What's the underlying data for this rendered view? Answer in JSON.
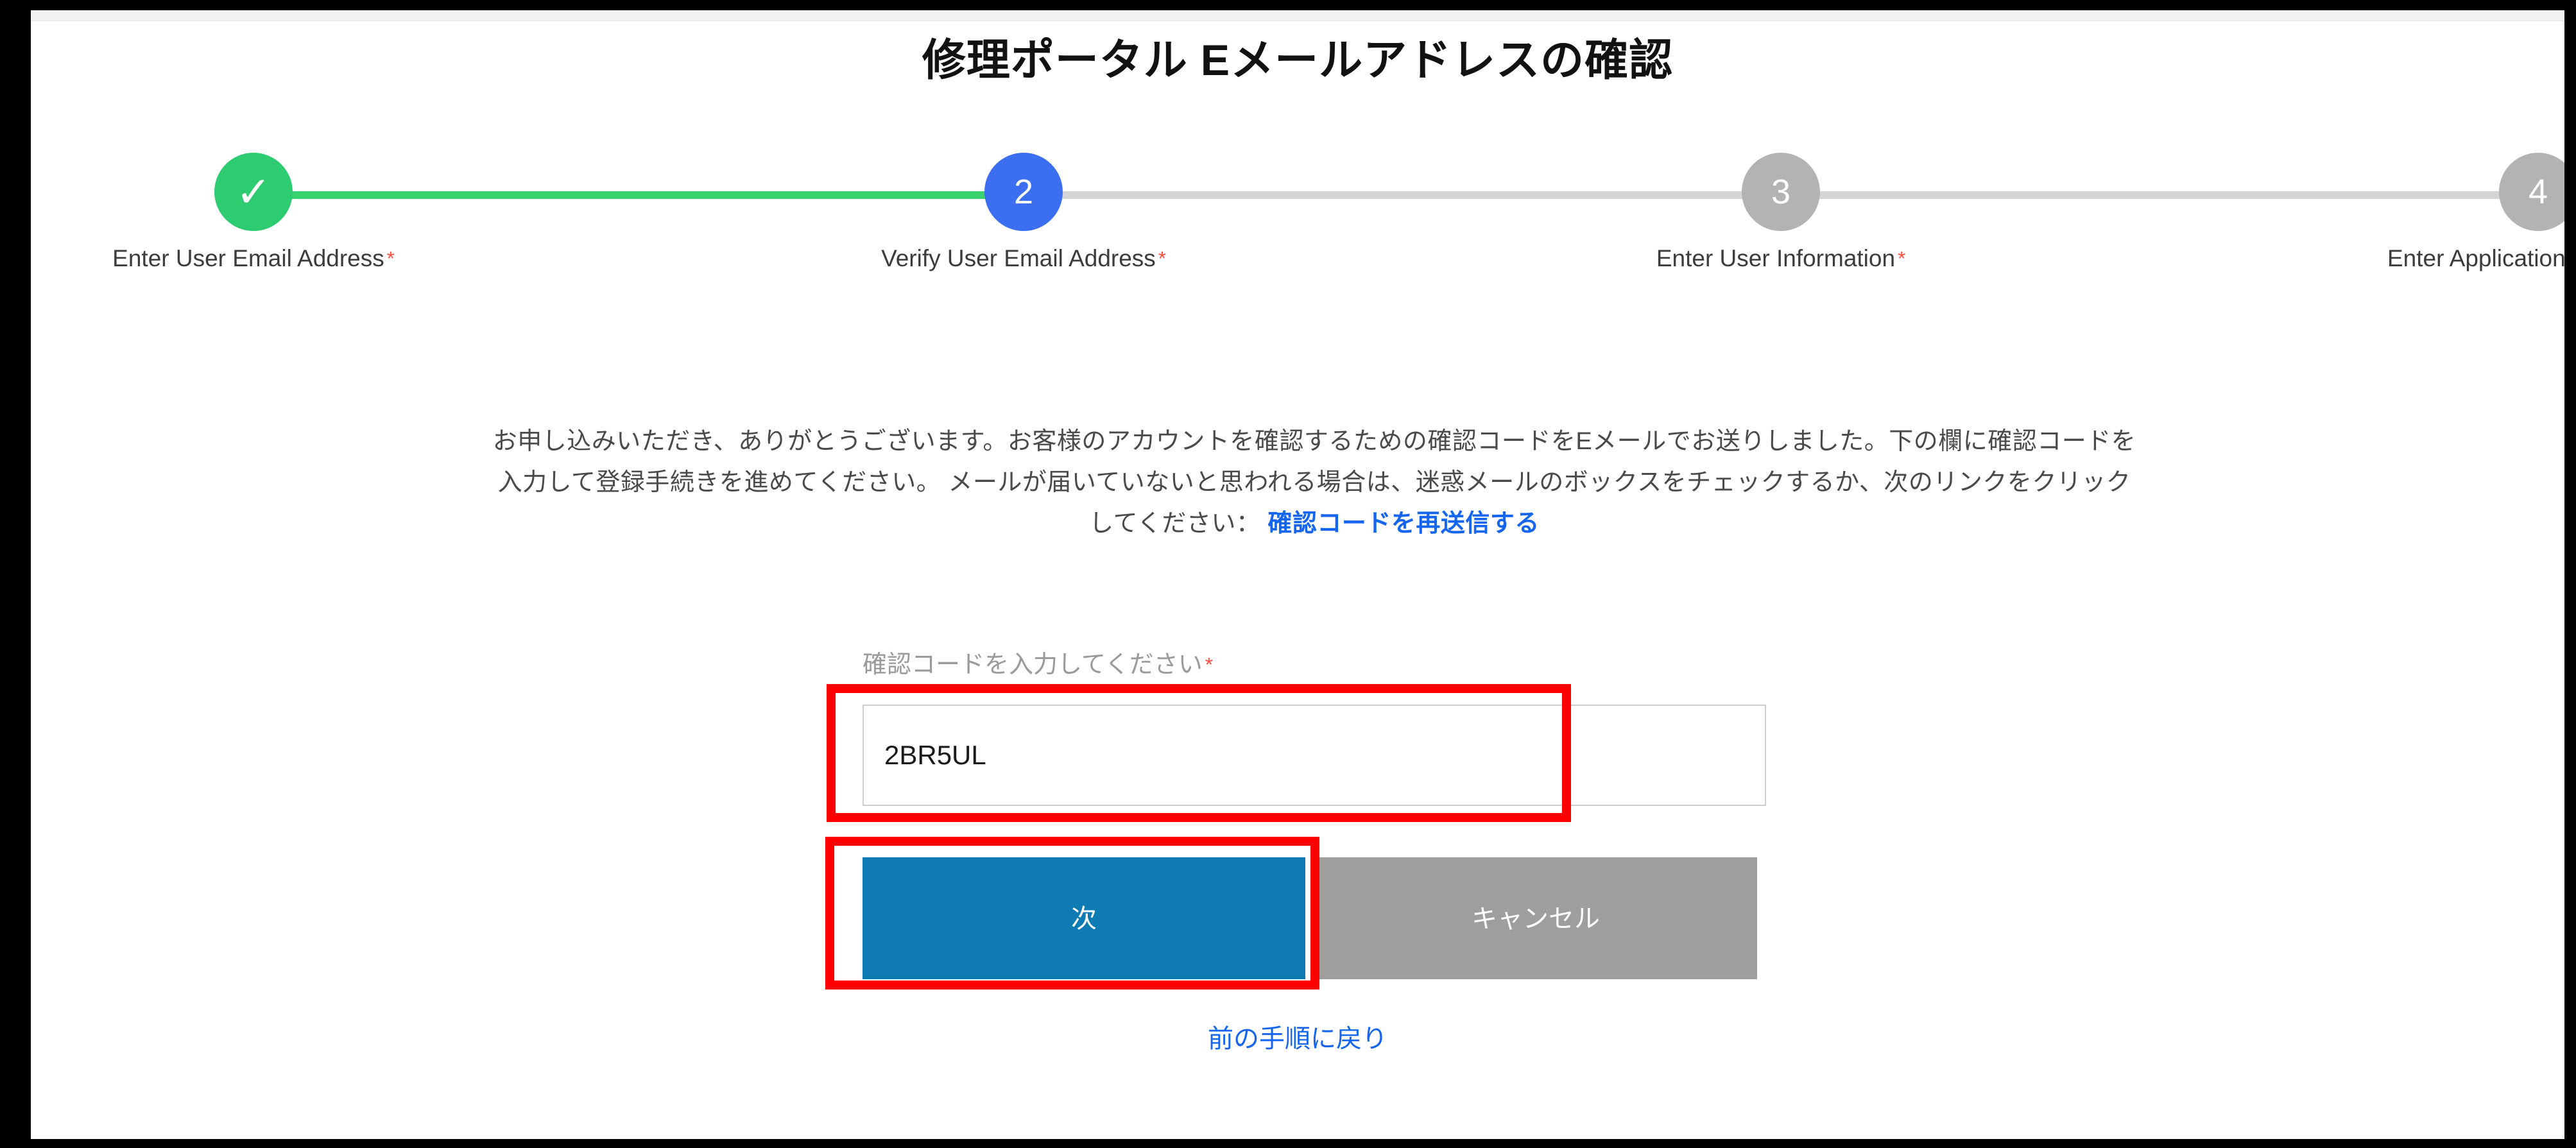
{
  "page": {
    "title": "修理ポータル Eメールアドレスの確認"
  },
  "stepper": {
    "steps": [
      {
        "marker": "✓",
        "label": "Enter User Email Address",
        "required_mark": "*",
        "state": "done"
      },
      {
        "marker": "2",
        "label": "Verify User Email Address",
        "required_mark": "*",
        "state": "active"
      },
      {
        "marker": "3",
        "label": "Enter User Information",
        "required_mark": "*",
        "state": "todo"
      },
      {
        "marker": "4",
        "label": "Enter Application Information",
        "required_mark": "*",
        "state": "todo"
      }
    ],
    "colors": {
      "done": "#2ecc71",
      "active": "#3b6ef0",
      "todo": "#b3b3b3",
      "track_done": "#3ad16f",
      "track_todo": "#d4d4d4"
    }
  },
  "intro": {
    "line1": "お申し込みいただき、ありがとうございます。お客様のアカウントを確認するための確認コードをEメールでお送りしました。下の欄に確認コードを",
    "line2": "入力して登録手続きを進めてください。 メールが届いていないと思われる場合は、迷惑メールのボックスをチェックするか、次のリンクをクリック",
    "line3_prefix": "してください：",
    "resend_link": "確認コードを再送信する"
  },
  "form": {
    "code_label": "確認コードを入力してください",
    "required_mark": "*",
    "code_value": "2BR5UL",
    "code_placeholder": "",
    "next_label": "次",
    "cancel_label": "キャンセル",
    "back_link": "前の手順に戻り"
  },
  "colors": {
    "primary_button": "#0e7bb5",
    "cancel_button": "#9e9e9e",
    "link": "#1565f0",
    "required": "#ff4a3d",
    "annotation": "#ff0000"
  }
}
